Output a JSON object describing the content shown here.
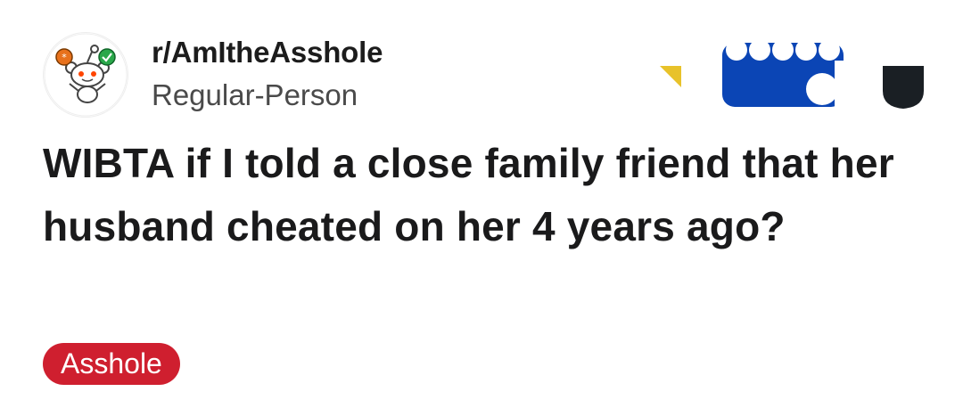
{
  "post": {
    "subreddit": "r/AmItheAsshole",
    "author": "Regular-Person",
    "title": "WIBTA if I told a close family friend that her husband cheated on her 4 years ago?",
    "flair": "Asshole"
  },
  "colors": {
    "flair_bg": "#cf1f2f",
    "flair_text": "#ffffff",
    "title_text": "#1a1a1b",
    "username_text": "#4a4a4a",
    "award_blue": "#0b45b5",
    "award_gold": "#e8c22a"
  },
  "icons": {
    "subreddit_avatar": "snoo-mascot-icon",
    "awards": [
      "gold-award-icon",
      "blue-wave-award-icon",
      "shield-award-icon"
    ]
  }
}
